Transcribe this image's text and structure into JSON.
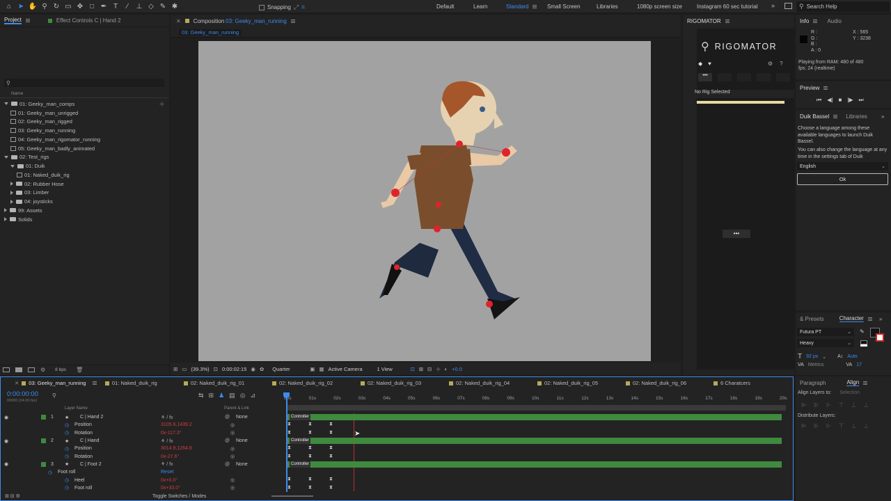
{
  "toolbar": {
    "snapping_label": "Snapping",
    "workspaces": [
      "Default",
      "Learn",
      "Standard",
      "Small Screen",
      "Libraries",
      "1080p screen size",
      "Instagram 60 sec tutorial"
    ],
    "active_workspace": "Standard",
    "search_placeholder": "Search Help"
  },
  "project_panel": {
    "tab_label": "Project",
    "effect_controls_label": "Effect Controls C | Hand 2",
    "name_header": "Name",
    "items": [
      {
        "label": "01: Geeky_man_comps",
        "type": "folder",
        "depth": 0,
        "open": true
      },
      {
        "label": "01: Geeky_man_unrigged",
        "type": "comp",
        "depth": 1
      },
      {
        "label": "02: Geeky_man_rigged",
        "type": "comp",
        "depth": 1
      },
      {
        "label": "03: Geeky_man_running",
        "type": "comp",
        "depth": 1
      },
      {
        "label": "04: Geeky_man_rigomator_running",
        "type": "comp",
        "depth": 1
      },
      {
        "label": "05: Geeky_man_badly_animated",
        "type": "comp",
        "depth": 1
      },
      {
        "label": "02: Test_rigs",
        "type": "folder",
        "depth": 0,
        "open": true
      },
      {
        "label": "01: Duik",
        "type": "folder",
        "depth": 1,
        "open": true
      },
      {
        "label": "01: Naked_duik_rig",
        "type": "comp",
        "depth": 2
      },
      {
        "label": "02: Rubber Hose",
        "type": "folder",
        "depth": 1,
        "open": false
      },
      {
        "label": "03: Limber",
        "type": "folder",
        "depth": 1,
        "open": false
      },
      {
        "label": "04: joysticks",
        "type": "folder",
        "depth": 1,
        "open": false
      },
      {
        "label": "99: Assets",
        "type": "folder",
        "depth": 0,
        "open": false
      },
      {
        "label": "Solids",
        "type": "folder",
        "depth": 0,
        "open": false
      }
    ],
    "bpc_label": "8 bpc"
  },
  "composition": {
    "panel_label": "Composition",
    "comp_name": "03: Geeky_man_running",
    "breadcrumb": "03: Geeky_man_running",
    "zoom": "(39.3%)",
    "timecode": "0:00:02:15",
    "resolution": "Quarter",
    "camera": "Active Camera",
    "view": "1 View",
    "exposure": "+0.0"
  },
  "rigomator": {
    "panel_label": "RIGOMATOR",
    "logo": "RIGOMATOR",
    "status": "No Rig Selected",
    "more_label": "•••",
    "loading": "•••"
  },
  "info": {
    "tab_label": "Info",
    "audio_label": "Audio",
    "r": "R :",
    "g": "G :",
    "b": "B :",
    "a": "A : 0",
    "x": "X : 565",
    "y": "Y : 3238",
    "playing": "Playing from RAM: 480 of 480",
    "fps": "fps: 24 (realtime)"
  },
  "preview": {
    "label": "Preview"
  },
  "duik": {
    "tab_label": "Duik Bassel",
    "libraries_label": "Libraries",
    "text1": "Choose a language among these available languages to launch Duik Bassel.",
    "text2": "You can also change the language at any time in the settings tab of Duik",
    "language": "English",
    "ok_label": "Ok"
  },
  "character": {
    "presets_label": "& Presets",
    "tab_label": "Character",
    "font": "Futura PT",
    "style": "Heavy",
    "size": "92 px",
    "leading": "Auto",
    "metrics": "Metrics",
    "tracking": "17"
  },
  "align": {
    "paragraph_label": "Paragraph",
    "tab_label": "Align",
    "align_to_label": "Align Layers to:",
    "align_to_value": "Selection",
    "distribute_label": "Distribute Layers:"
  },
  "timeline": {
    "tabs": [
      "03: Geeky_man_running",
      "01: Naked_duik_rig",
      "02: Naked_duik_rig_01",
      "02: Naked_duik_rig_02",
      "02: Naked_duik_rig_03",
      "02: Naked_duik_rig_04",
      "02: Naked_duik_rig_05",
      "02: Naked_duik_rig_06",
      "6 Charatcers"
    ],
    "timecode": "0:00:00:00",
    "fps": "00000 (24.00 fps)",
    "layer_name_header": "Layer Name",
    "parent_header": "Parent & Link",
    "ruler": [
      "00s",
      "01s",
      "02s",
      "03s",
      "04s",
      "05s",
      "06s",
      "07s",
      "08s",
      "09s",
      "10s",
      "11s",
      "12s",
      "13s",
      "14s",
      "15s",
      "16s",
      "17s",
      "18s",
      "19s",
      "20s"
    ],
    "rows": [
      {
        "type": "layer",
        "num": "1",
        "name": "C | Hand 2",
        "parent": "None",
        "bar": "Controller"
      },
      {
        "type": "prop",
        "name": "Position",
        "value": "3105.6,1439.2"
      },
      {
        "type": "prop",
        "name": "Rotation",
        "value": "0x-117.3°"
      },
      {
        "type": "layer",
        "num": "2",
        "name": "C | Hand",
        "parent": "None",
        "bar": "Controller"
      },
      {
        "type": "prop",
        "name": "Position",
        "value": "3014.9,1264.8"
      },
      {
        "type": "prop",
        "name": "Rotation",
        "value": "0x-27.6°"
      },
      {
        "type": "layer",
        "num": "3",
        "name": "C | Foot 2",
        "parent": "None",
        "bar": "Controller"
      },
      {
        "type": "fx",
        "name": "Foot roll",
        "value": "Reset"
      },
      {
        "type": "prop",
        "name": "Heel",
        "value": "0x+0.0°"
      },
      {
        "type": "prop",
        "name": "Foot roll",
        "value": "0x+33.0°"
      }
    ],
    "toggle_label": "Toggle Switches / Modes"
  }
}
